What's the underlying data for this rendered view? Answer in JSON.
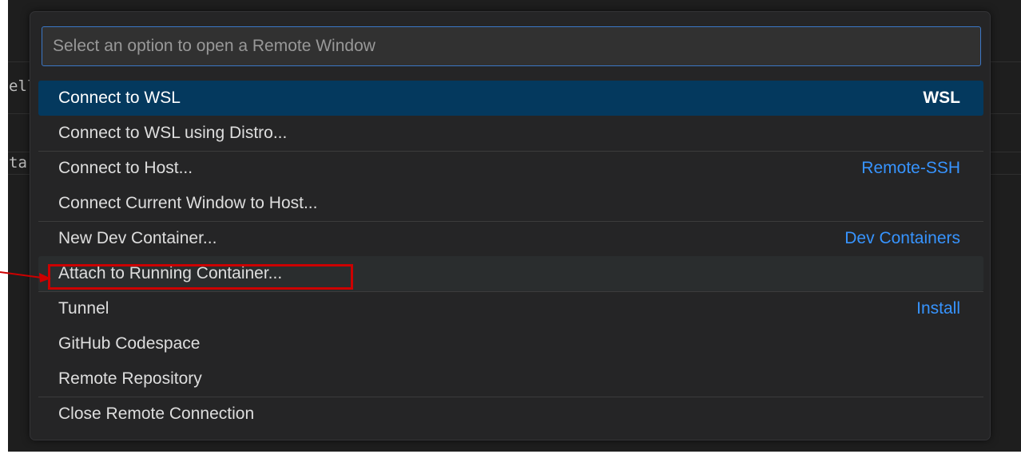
{
  "background_fragments": [
    "ell",
    "ta"
  ],
  "quick_pick": {
    "placeholder": "Select an option to open a Remote Window",
    "items": [
      {
        "label": "Connect to WSL",
        "group": "WSL"
      },
      {
        "label": "Connect to WSL using Distro...",
        "group": ""
      },
      {
        "label": "Connect to Host...",
        "group": "Remote-SSH"
      },
      {
        "label": "Connect Current Window to Host...",
        "group": ""
      },
      {
        "label": "New Dev Container...",
        "group": "Dev Containers"
      },
      {
        "label": "Attach to Running Container...",
        "group": ""
      },
      {
        "label": "Tunnel",
        "group": "Install"
      },
      {
        "label": "GitHub Codespace",
        "group": ""
      },
      {
        "label": "Remote Repository",
        "group": ""
      },
      {
        "label": "Close Remote Connection",
        "group": ""
      }
    ]
  },
  "annotation": {
    "highlight_color": "#cc0000",
    "highlighted_item": "Attach to Running Container..."
  },
  "colors": {
    "selected_bg": "#04395e",
    "accent_link": "#3794ff",
    "input_border": "#3b77c6"
  }
}
